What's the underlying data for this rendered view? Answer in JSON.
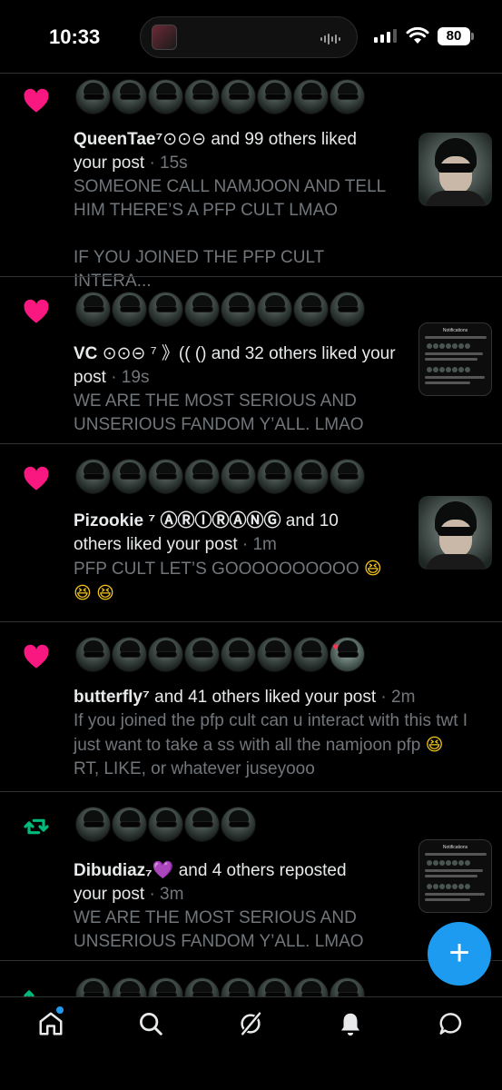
{
  "status_bar": {
    "time": "10:33",
    "battery": "80"
  },
  "feed": [
    {
      "type": "like",
      "avatar_count": 8,
      "name": "QueenTae⁷",
      "name_extra": "⊙⊙⊝",
      "action": "and 99 others liked",
      "action2": "your post",
      "age": "· 15s",
      "snippet": "SOMEONE CALL NAMJOON AND TELL HIM THERE’S A PFP CULT LMAO\n\nIF YOU JOINED THE PFP CULT INTERA...",
      "thumbnail": "photo"
    },
    {
      "type": "like",
      "avatar_count": 8,
      "name": "VC",
      "name_extra": "⊙⊙⊝ ⁷ 》(( ()",
      "action": "and 32 others liked your",
      "action2": "post",
      "age": "· 19s",
      "snippet": "WE ARE THE MOST SERIOUS AND UNSERIOUS FANDOM Y’ALL. LMAO",
      "thumbnail": "screenshot",
      "thumbnail_header": "Notifications"
    },
    {
      "type": "like",
      "avatar_count": 8,
      "name": "Pizookie ⁷ ⒶⓇⒾⓇⒶⓃⒼ",
      "name_extra": "",
      "action": "and 10",
      "action2": "others liked your post",
      "age": "· 1m",
      "snippet": "PFP CULT LET’S GOOOOOOOOOO",
      "emoji": "😆",
      "thumbnail": "photo"
    },
    {
      "type": "like",
      "avatar_count": 8,
      "name": "butterfly⁷",
      "name_extra": "",
      "action": "and 41 others liked your post",
      "action2": "",
      "age": "· 2m",
      "snippet": "If you joined the pfp cult can u interact with this twt I just want to take a ss with all the namjoon pfp",
      "snippet_tail": "RT, LIKE, or whatever juseyooo",
      "emoji": "😆",
      "thumbnail": ""
    },
    {
      "type": "repost",
      "avatar_count": 5,
      "name": "Dibudiaz₇",
      "name_extra": "💜",
      "action": "and 4 others reposted",
      "action2": "your post",
      "age": "· 3m",
      "snippet": "WE ARE THE MOST SERIOUS AND UNSERIOUS FANDOM Y’ALL. LMAO",
      "thumbnail": "screenshot",
      "thumbnail_header": "Notifications"
    },
    {
      "type": "repost",
      "avatar_count": 8
    }
  ],
  "fab": {
    "label": "+"
  },
  "nav": [
    "home",
    "search",
    "grok",
    "notifications",
    "messages"
  ],
  "colors": {
    "like": "#f91880",
    "repost": "#00ba7c",
    "accent": "#1d9bf0",
    "muted": "#71767b"
  }
}
